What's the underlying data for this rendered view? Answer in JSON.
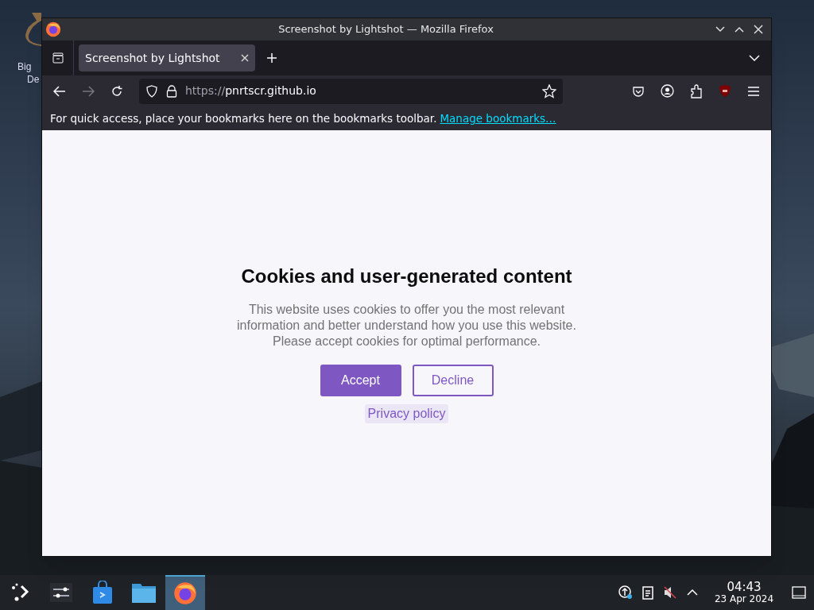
{
  "desktop": {
    "icons": [
      {
        "label": "Big",
        "sublabel": "De"
      }
    ]
  },
  "window": {
    "title": "Screenshot by Lightshot — Mozilla Firefox"
  },
  "tabs": [
    {
      "label": "Screenshot by Lightshot",
      "selected": true
    }
  ],
  "address_bar": {
    "scheme": "https://",
    "host": "pnrtscr.github.io"
  },
  "bookmarks_bar": {
    "message": "For quick access, place your bookmarks here on the bookmarks toolbar.",
    "link": "Manage bookmarks…"
  },
  "cookie_dialog": {
    "title": "Cookies and user-generated content",
    "body": "This website uses cookies to offer you the most relevant information and better understand how you use this website. Please accept cookies for optimal performance.",
    "buttons": [
      {
        "label": "Accept",
        "kind": "primary"
      },
      {
        "label": "Decline",
        "kind": "outline"
      }
    ],
    "link": "Privacy policy"
  },
  "taskbar": {
    "apps": [
      {
        "kind": "settings",
        "selected": false
      },
      {
        "kind": "store",
        "selected": false
      },
      {
        "kind": "files",
        "selected": false
      },
      {
        "kind": "firefox",
        "selected": true
      }
    ],
    "time": "04:43",
    "date": "23 Apr 2024"
  }
}
